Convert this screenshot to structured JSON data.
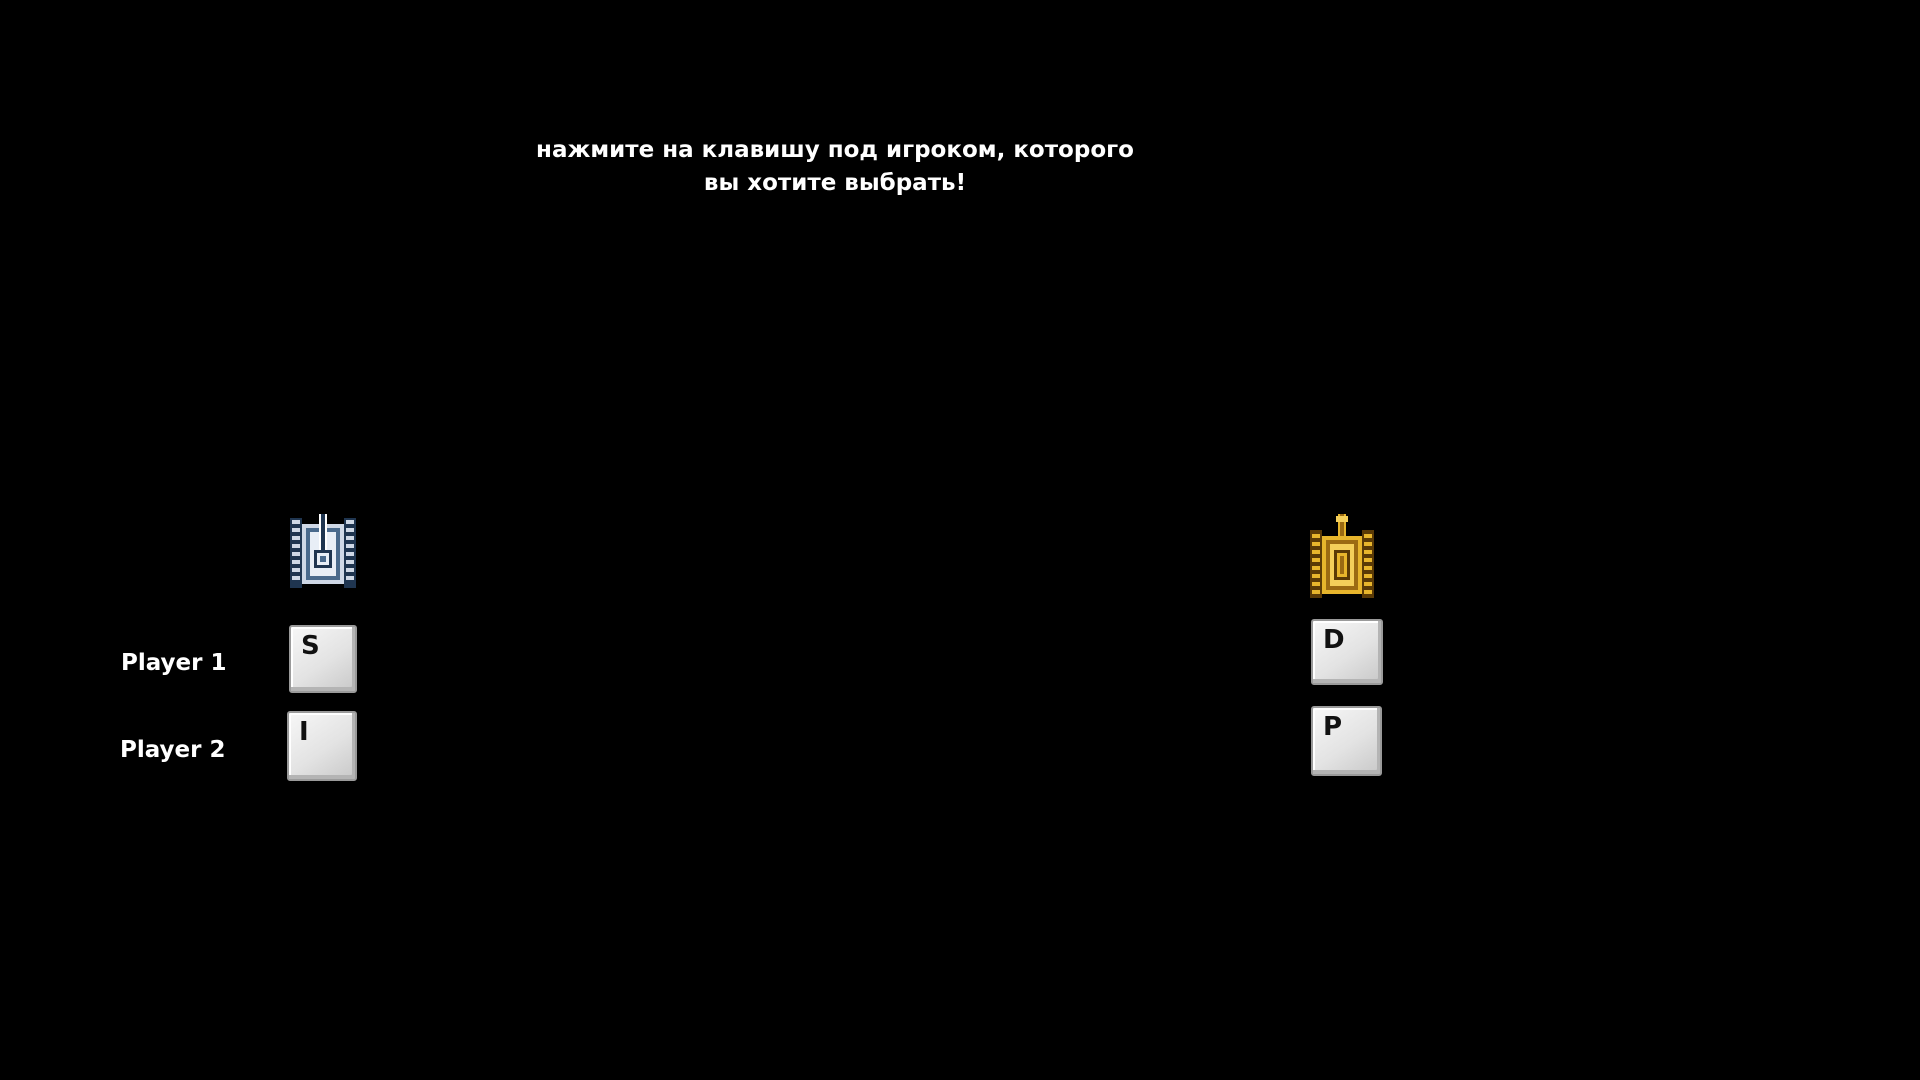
{
  "instruction": {
    "line1": "нажмите на клавишу под игроком, которого",
    "line2": "вы хотите выбрать!"
  },
  "players": [
    {
      "label": "Player 1"
    },
    {
      "label": "Player 2"
    }
  ],
  "characters": [
    {
      "name": "silver-tank",
      "icon": "silver-tank-icon",
      "keys": {
        "player1": "S",
        "player2": "I"
      },
      "colors": {
        "body": "#cfd8e6",
        "shade": "#4a6a8c",
        "dark": "#1f3550"
      }
    },
    {
      "name": "gold-tank",
      "icon": "gold-tank-icon",
      "keys": {
        "player1": "D",
        "player2": "P"
      },
      "colors": {
        "body": "#e7b52c",
        "shade": "#9b6a12",
        "dark": "#5a3a06"
      }
    }
  ],
  "background_color": "#000000"
}
